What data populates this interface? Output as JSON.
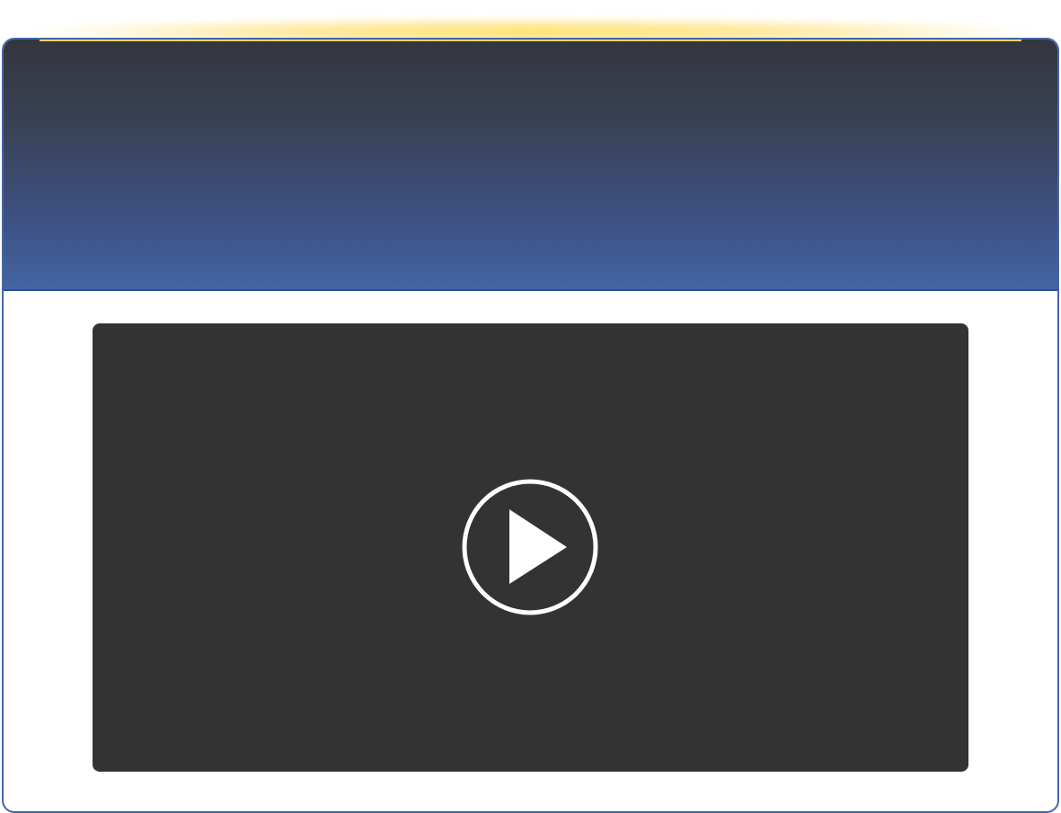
{
  "page": {
    "header_gradient": [
      "#34363c",
      "#4364a2"
    ],
    "accent_glow": "#ffd84a",
    "border_color": "#4466a8"
  },
  "video": {
    "background": "#333333",
    "icon": "play-circle-icon"
  }
}
